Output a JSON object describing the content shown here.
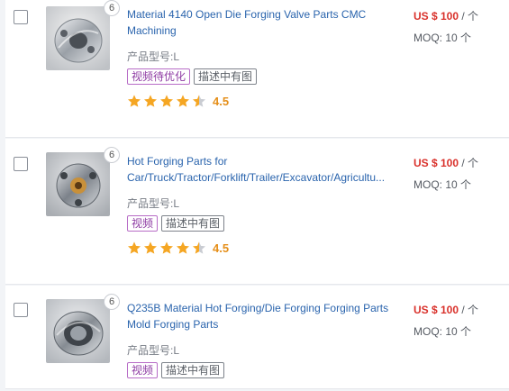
{
  "products": [
    {
      "image_count": "6",
      "title_line1": "Material 4140 Open Die Forging Valve Parts CMC",
      "title_line2": "Machining",
      "model": "产品型号:L",
      "tags": [
        "视频待优化",
        "描述中有图"
      ],
      "rating": "4.5",
      "price": "US $ 100",
      "price_unit": " / 个",
      "moq": "MOQ: 10 个"
    },
    {
      "image_count": "6",
      "title_line1": "Hot Forging Parts for",
      "title_line2": "Car/Truck/Tractor/Forklift/Trailer/Excavator/Agricultu...",
      "model": "产品型号:L",
      "tags": [
        "视频",
        "描述中有图"
      ],
      "rating": "4.5",
      "price": "US $ 100",
      "price_unit": " / 个",
      "moq": "MOQ: 10 个"
    },
    {
      "image_count": "6",
      "title_line1": "Q235B Material Hot Forging/Die Forging Forging Parts",
      "title_line2": "Mold Forging Parts",
      "model": "产品型号:L",
      "tags": [
        "视频",
        "描述中有图"
      ],
      "price": "US $ 100",
      "price_unit": " / 个",
      "moq": "MOQ: 10 个"
    }
  ],
  "colors": {
    "title_link": "#2a64ad",
    "price": "#d9312b",
    "star": "#f5a623",
    "rating_text": "#e58f1a",
    "tag_purple": "#8e3ba3"
  },
  "icons": {
    "star": "star-icon",
    "half_star": "half-star-icon",
    "checkbox": "checkbox-icon"
  }
}
